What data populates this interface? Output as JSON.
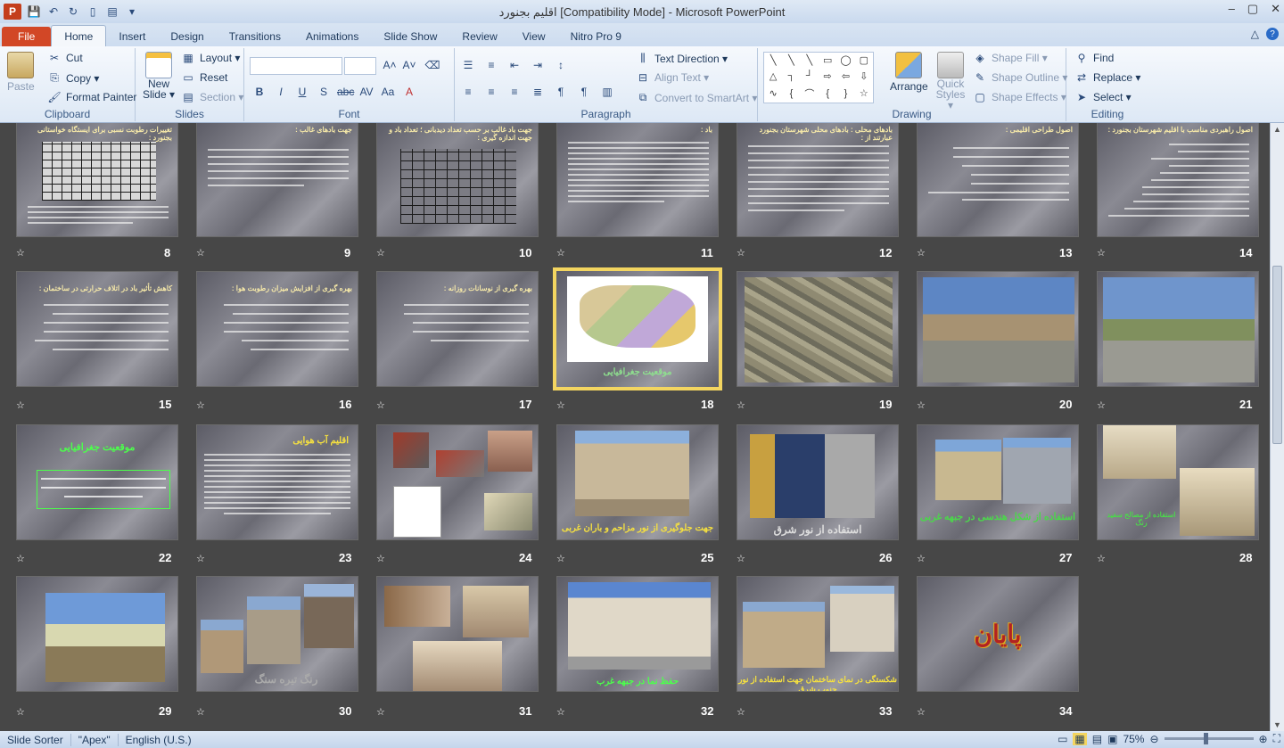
{
  "window": {
    "title": "اقلیم بجنورد [Compatibility Mode]  -  Microsoft PowerPoint",
    "app_icon": "P",
    "controls": [
      "–",
      "▢",
      "✕"
    ]
  },
  "tabs": [
    "File",
    "Home",
    "Insert",
    "Design",
    "Transitions",
    "Animations",
    "Slide Show",
    "Review",
    "View",
    "Nitro Pro 9"
  ],
  "tabs_right": [
    "△",
    "?"
  ],
  "ribbon": {
    "clipboard": {
      "label": "Clipboard",
      "paste": "Paste",
      "cut": "Cut",
      "copy": "Copy ▾",
      "format_painter": "Format Painter"
    },
    "slides": {
      "label": "Slides",
      "new_slide": "New Slide ▾",
      "layout": "Layout ▾",
      "reset": "Reset",
      "section": "Section ▾"
    },
    "font": {
      "label": "Font"
    },
    "paragraph": {
      "label": "Paragraph",
      "text_direction": "Text Direction ▾",
      "align_text": "Align Text ▾",
      "convert": "Convert to SmartArt ▾"
    },
    "drawing": {
      "label": "Drawing",
      "arrange": "Arrange",
      "quick_styles": "Quick Styles ▾",
      "shape_fill": "Shape Fill ▾",
      "shape_outline": "Shape Outline ▾",
      "shape_effects": "Shape Effects ▾"
    },
    "editing": {
      "label": "Editing",
      "find": "Find",
      "replace": "Replace ▾",
      "select": "Select ▾"
    }
  },
  "slides": {
    "row1": [
      {
        "num": "8",
        "title": "تغییرات رطوبت نسبی برای ایستگاه خواستانی بجنورد :"
      },
      {
        "num": "9",
        "title": "جهت بادهای غالب :"
      },
      {
        "num": "10",
        "title": "جهت باد غالب بر حسب تعداد دیدبانی ؛ تعداد باد و جهت اندازه گیری :"
      },
      {
        "num": "11",
        "title": "باد :"
      },
      {
        "num": "12",
        "title": "بادهای محلی : بادهای محلی شهرستان بجنورد عبارتند از :"
      },
      {
        "num": "13",
        "title": "اصول طراحی اقلیمی :"
      },
      {
        "num": "14",
        "title": "اصول راهبردی مناسب با اقلیم شهرستان بجنورد :"
      }
    ],
    "row2": [
      {
        "num": "15",
        "title": "کاهش تأثیر باد در اتلاف حرارتی در ساختمان :"
      },
      {
        "num": "16",
        "title": "بهره گیری از افزایش میزان رطوبت هوا :"
      },
      {
        "num": "17",
        "title": "بهره گیری از نوسانات روزانه :"
      },
      {
        "num": "18",
        "caption": "موقعیت جغرافیایی"
      },
      {
        "num": "19"
      },
      {
        "num": "20"
      },
      {
        "num": "21"
      }
    ],
    "row3": [
      {
        "num": "22",
        "title": "موقعیت جغرافیایی"
      },
      {
        "num": "23",
        "title": "اقلیم آب هوایی"
      },
      {
        "num": "24"
      },
      {
        "num": "25",
        "caption": "جهت جلوگیری از نور مزاحم و باران غربی"
      },
      {
        "num": "26",
        "caption": "استفاده از نور شرق"
      },
      {
        "num": "27",
        "caption": "استفاده از شکل هندسی در جبهه غربی"
      },
      {
        "num": "28",
        "caption": "استفاده از مصالح سفید رنگ"
      }
    ],
    "row4": [
      {
        "num": "29"
      },
      {
        "num": "30",
        "caption": "رنگ تیره سنگ"
      },
      {
        "num": "31"
      },
      {
        "num": "32",
        "caption": "حفظ نما در جبهه غرب"
      },
      {
        "num": "33",
        "caption": "شکستگی در نمای ساختمان جهت استفاده از نور جنوب شرق"
      },
      {
        "num": "34",
        "caption": "پایان"
      }
    ],
    "star": "☆"
  },
  "status": {
    "view": "Slide Sorter",
    "theme": "\"Apex\"",
    "language": "English (U.S.)",
    "zoom": "75%"
  },
  "colors": {
    "selection": "#f3d560",
    "sorter_bg": "#474747",
    "file_tab": "#d24726"
  }
}
